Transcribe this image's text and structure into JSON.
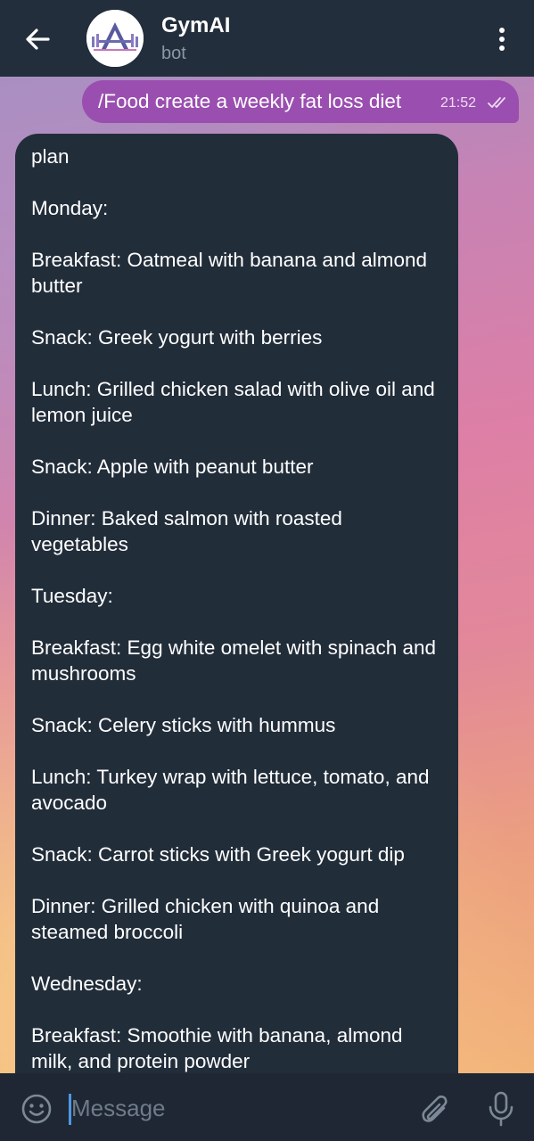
{
  "header": {
    "title": "GymAI",
    "subtitle": "bot",
    "back_icon": "arrow-left-icon",
    "menu_icon": "more-vertical-icon"
  },
  "outgoing_message": {
    "text": "/Food create a weekly fat loss diet",
    "time": "21:52",
    "status_icon": "double-check-icon"
  },
  "incoming_message": {
    "paragraphs": [
      "plan",
      "Monday:",
      "Breakfast: Oatmeal with banana and almond butter",
      "Snack: Greek yogurt with berries",
      "Lunch: Grilled chicken salad with olive oil and lemon juice",
      "Snack: Apple with peanut butter",
      "Dinner: Baked salmon with roasted vegetables",
      "Tuesday:",
      "Breakfast: Egg white omelet with spinach and mushrooms",
      "Snack: Celery sticks with hummus",
      "Lunch: Turkey wrap with lettuce, tomato, and avocado",
      "Snack: Carrot sticks with Greek yogurt dip",
      "Dinner: Grilled chicken with quinoa and steamed broccoli",
      "Wednesday:",
      "Breakfast: Smoothie with banana, almond milk, and protein powder"
    ]
  },
  "composer": {
    "placeholder": "Message",
    "emoji_icon": "emoji-icon",
    "attach_icon": "paperclip-icon",
    "mic_icon": "microphone-icon"
  },
  "colors": {
    "header_bg": "#232e3c",
    "outgoing_bubble": "#9a4fb0",
    "incoming_bubble": "#222d3a",
    "input_bar_bg": "#1e2733"
  }
}
